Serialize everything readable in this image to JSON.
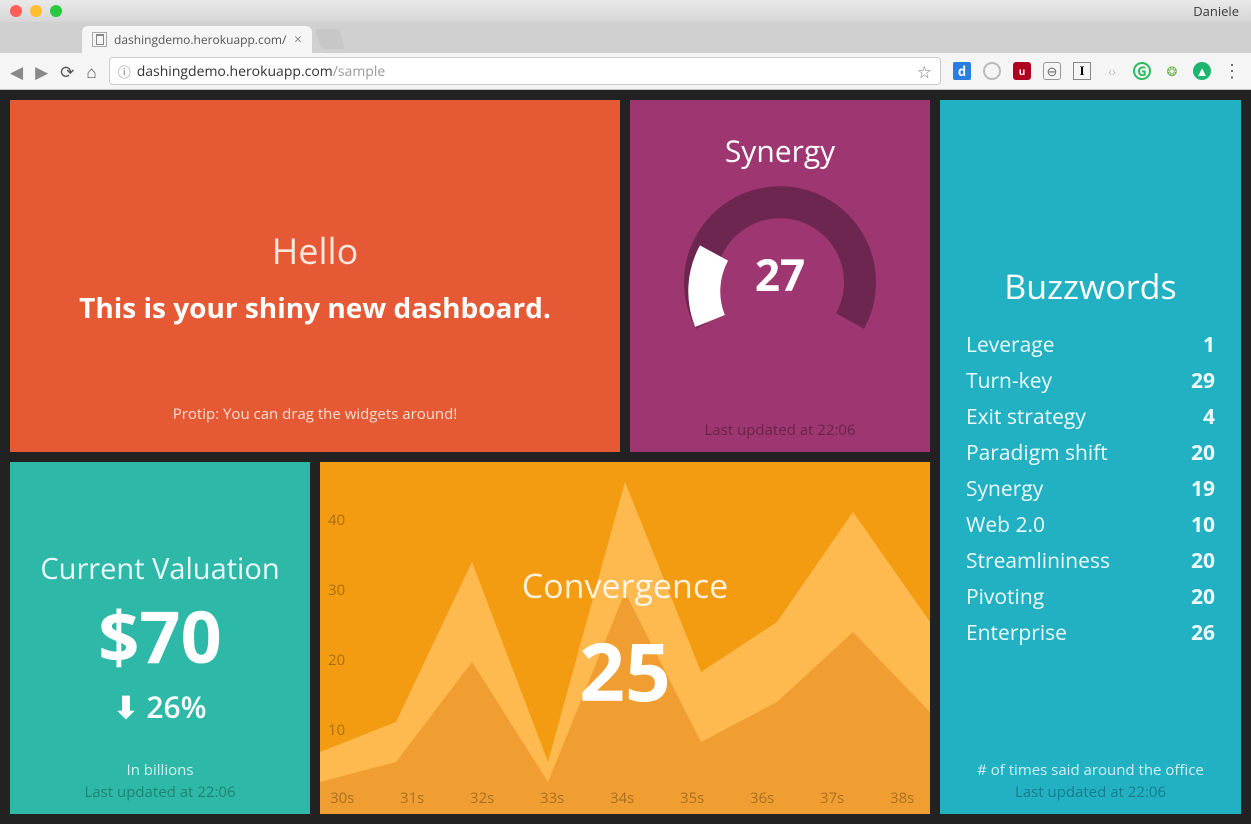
{
  "browser": {
    "profile": "Daniele",
    "tab_title": "dashingdemo.herokuapp.com/",
    "url_host": "dashingdemo.herokuapp.com",
    "url_path": "/sample"
  },
  "welcome": {
    "title": "Hello",
    "text": "This is your shiny new dashboard.",
    "moreinfo": "Protip: You can drag the widgets around!"
  },
  "synergy": {
    "title": "Synergy",
    "value": "27",
    "updated": "Last updated at 22:06"
  },
  "valuation": {
    "title": "Current Valuation",
    "value": "$70",
    "change": "26%",
    "direction": "down",
    "moreinfo": "In billions",
    "updated": "Last updated at 22:06"
  },
  "convergence": {
    "title": "Convergence",
    "value": "25"
  },
  "buzzwords": {
    "title": "Buzzwords",
    "items": [
      {
        "label": "Leverage",
        "value": "1"
      },
      {
        "label": "Turn-key",
        "value": "29"
      },
      {
        "label": "Exit strategy",
        "value": "4"
      },
      {
        "label": "Paradigm shift",
        "value": "20"
      },
      {
        "label": "Synergy",
        "value": "19"
      },
      {
        "label": "Web 2.0",
        "value": "10"
      },
      {
        "label": "Streamlininess",
        "value": "20"
      },
      {
        "label": "Pivoting",
        "value": "20"
      },
      {
        "label": "Enterprise",
        "value": "26"
      }
    ],
    "moreinfo": "# of times said around the office",
    "updated": "Last updated at 22:06"
  },
  "chart_data": [
    {
      "type": "gauge",
      "title": "Synergy",
      "value": 27,
      "min": 0,
      "max": 100
    },
    {
      "type": "area",
      "title": "Convergence",
      "x": [
        "30s",
        "31s",
        "32s",
        "33s",
        "34s",
        "35s",
        "36s",
        "37s",
        "38s"
      ],
      "values": [
        8,
        12,
        32,
        7,
        42,
        18,
        25,
        39,
        25
      ],
      "ylim": [
        0,
        45
      ],
      "yticks": [
        10,
        20,
        30,
        40
      ]
    }
  ]
}
